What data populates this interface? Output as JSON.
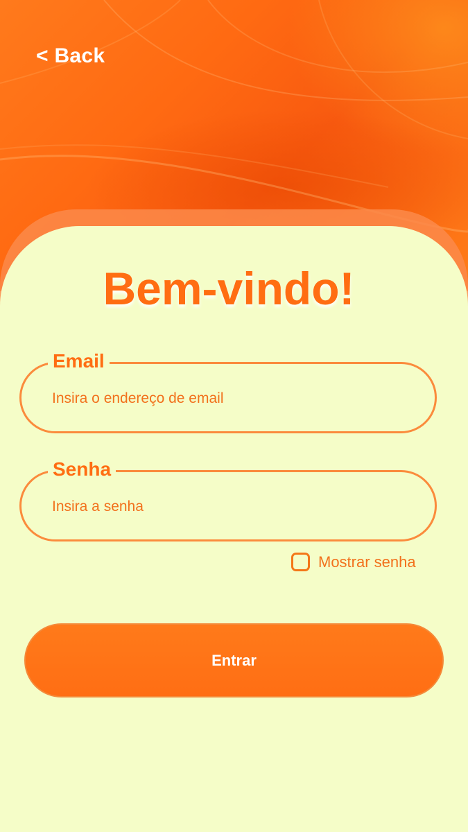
{
  "header": {
    "back_label": "< Back"
  },
  "login": {
    "title": "Bem-vindo!",
    "email": {
      "label": "Email",
      "placeholder": "Insira o endereço de email"
    },
    "password": {
      "label": "Senha",
      "placeholder": "Insira a senha"
    },
    "show_password": {
      "label": "Mostrar senha",
      "checked": false
    },
    "submit_label": "Entrar"
  },
  "colors": {
    "accent": "#ff6d12",
    "background": "#f5fdc8",
    "hero_gradient_start": "#ff7a1c",
    "hero_gradient_end": "#f85a10"
  }
}
